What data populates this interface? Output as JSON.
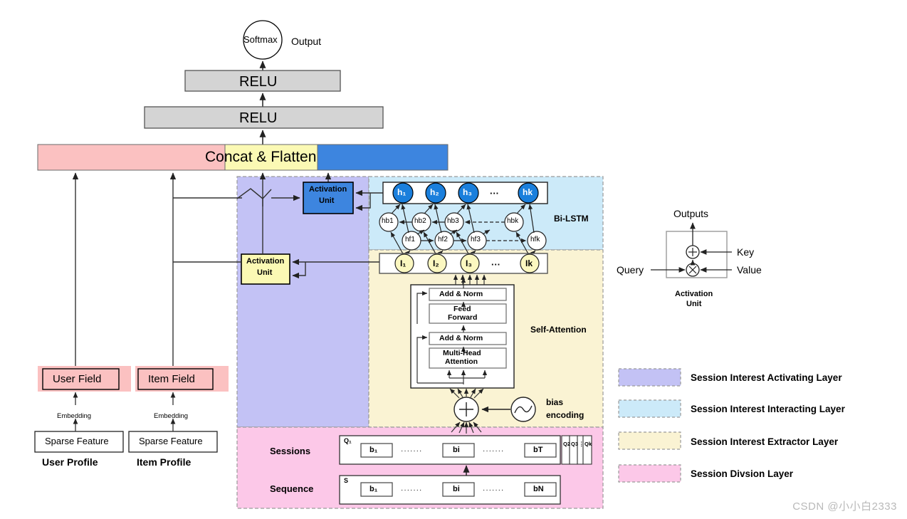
{
  "figure": {
    "title_watermark": "CSDN @小小白2333"
  },
  "output": {
    "softmax_label": "Softmax",
    "output_label": "Output"
  },
  "mlp": {
    "relu_top": "RELU",
    "relu_bottom": "RELU",
    "concat_label": "Concat & Flatten"
  },
  "profiles": {
    "user_field": "User Field",
    "item_field": "Item Field",
    "user_sparse": "Sparse Feature",
    "item_sparse": "Sparse Feature",
    "user_embedding": "Embedding",
    "item_embedding": "Embedding",
    "user_profile": "User Profile",
    "item_profile": "Item Profile"
  },
  "activating_layer": {
    "top_unit_line1": "Activation",
    "top_unit_line2": "Unit",
    "mid_unit_line1": "Activation",
    "mid_unit_line2": "Unit"
  },
  "interacting_layer": {
    "label": "Bi-LSTM",
    "hidden_outputs": [
      "h₁",
      "h₂",
      "h₃",
      "···",
      "hk"
    ],
    "backward_states": [
      "hb1",
      "hb2",
      "hb3",
      "hbk"
    ],
    "forward_states": [
      "hf1",
      "hf2",
      "hf3",
      "hfk"
    ]
  },
  "extractor_layer": {
    "label": "Self-Attention",
    "interest_states": [
      "I₁",
      "I₂",
      "I₃",
      "···",
      "Ik"
    ],
    "blocks": [
      "Add & Norm",
      "Feed Forward",
      "Add & Norm",
      "Multi-Head Attention"
    ],
    "bias_encoding_line1": "bias",
    "bias_encoding_line2": "encoding",
    "sum_symbol": "+"
  },
  "division_layer": {
    "sessions_label": "Sessions",
    "sequence_label": "Sequence",
    "sessions_row_tag": "Q₁",
    "sequence_row_tag": "S",
    "sessions_items": [
      "b₁",
      "·······",
      "bi",
      "·······",
      "bT"
    ],
    "sequence_items": [
      "b₁",
      "·······",
      "bi",
      "·······",
      "bN"
    ],
    "session_stack": [
      "Q2",
      "Q3",
      "⋮",
      "Qk"
    ]
  },
  "activation_unit_detail": {
    "outputs_label": "Outputs",
    "key_label": "Key",
    "value_label": "Value",
    "query_label": "Query",
    "sum_op": "+",
    "prod_op": "×",
    "caption_line1": "Activation",
    "caption_line2": "Unit"
  },
  "legend": {
    "items": [
      {
        "label": "Session Interest Activating Layer",
        "color": "#c3c2f5"
      },
      {
        "label": "Session Interest Interacting Layer",
        "color": "#cceaf9"
      },
      {
        "label": "Session Interest Extractor Layer",
        "color": "#faf3d3"
      },
      {
        "label": "Session Divsion Layer",
        "color": "#fcc8e8"
      }
    ]
  },
  "colors": {
    "pink_bar": "#fbc1c1",
    "yellow_bar": "#fbf9b4",
    "blue_bar": "#3d85df",
    "gray_box": "#d4d4d4",
    "blue_unit": "#3d85df",
    "yellow_unit": "#fbf9b4",
    "node_blue": "#1a7fdc",
    "node_yellow": "#fbf7c0",
    "purple_zone": "#c3c2f5",
    "lightblue_zone": "#cceaf9",
    "cream_zone": "#faf3d3",
    "pink_zone": "#fcc8e8"
  }
}
